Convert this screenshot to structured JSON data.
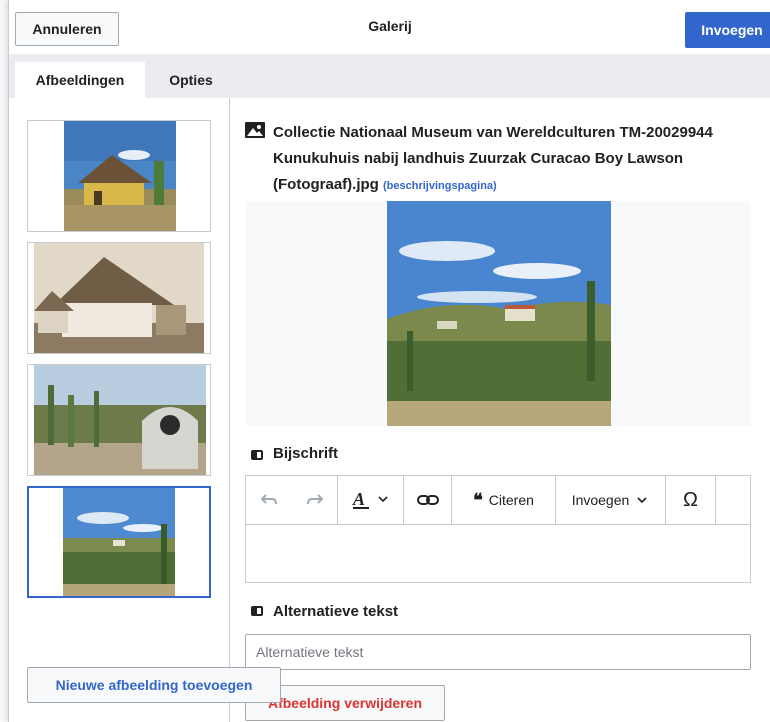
{
  "header": {
    "cancel_label": "Annuleren",
    "title": "Galerij",
    "insert_label": "Invoegen"
  },
  "tabs": [
    {
      "label": "Afbeeldingen",
      "active": true
    },
    {
      "label": "Opties",
      "active": false
    }
  ],
  "gallery": {
    "images": [
      {
        "alt": "yellow thatched house",
        "selected": false
      },
      {
        "alt": "sepia kunuku hut",
        "selected": false
      },
      {
        "alt": "oven in cactus field",
        "selected": false
      },
      {
        "alt": "Kunukuhuis nabij landhuis Zuurzak",
        "selected": true
      }
    ],
    "add_label": "Nieuwe afbeelding toevoegen"
  },
  "detail": {
    "file_title": "Collectie Nationaal Museum van Wereldculturen TM-20029944 Kunukuhuis nabij landhuis Zuurzak Curacao Boy Lawson (Fotograaf).jpg",
    "description_link": "(beschrijvingspagina)",
    "caption_label": "Bijschrift",
    "toolbar": {
      "cite_label": "Citeren",
      "insert_label": "Invoegen",
      "special_char": "Ω"
    },
    "alt_label": "Alternatieve tekst",
    "alt_placeholder": "Alternatieve tekst",
    "remove_label": "Afbeelding verwijderen"
  },
  "colors": {
    "progressive": "#3366cc",
    "destructive": "#d33333",
    "border": "#c8ccd1"
  }
}
